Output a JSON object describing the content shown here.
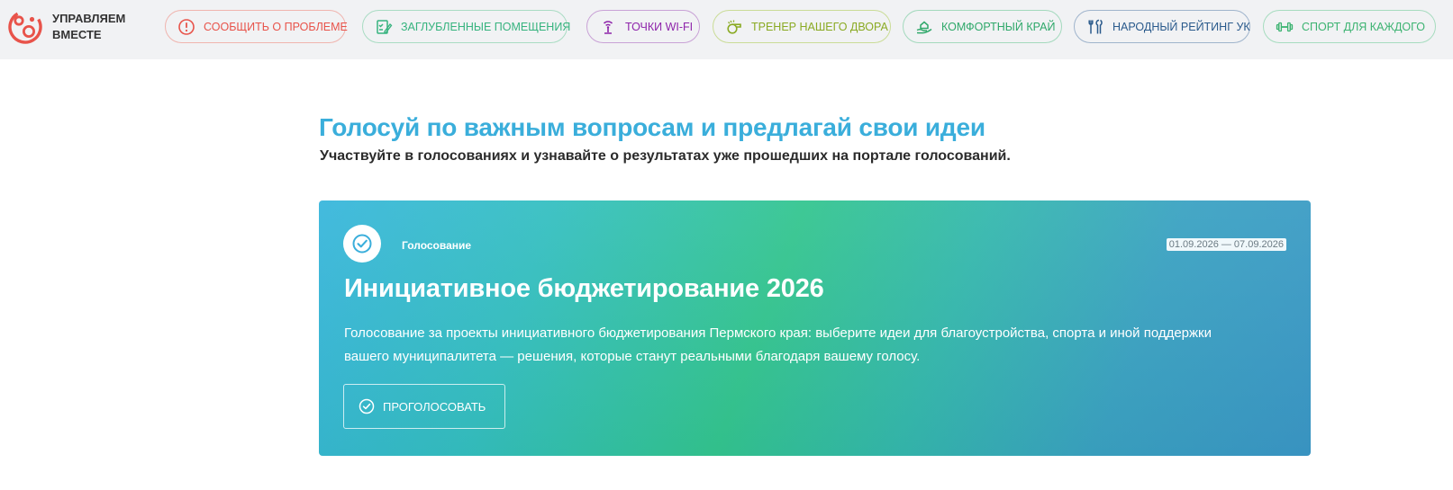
{
  "brand": {
    "name": "УПРАВЛЯЕМ ВМЕСТЕ",
    "color": "#e8534a"
  },
  "nav": [
    {
      "label": "СООБЩИТЬ О ПРОБЛЕМЕ",
      "icon": "alert-circle-icon",
      "color": "#e8534a"
    },
    {
      "label": "ЗАГЛУБЛЕННЫЕ ПОМЕЩЕНИЯ",
      "icon": "checklist-pen-icon",
      "color": "#36b37e"
    },
    {
      "label": "ТОЧКИ WI-FI",
      "icon": "wifi-tower-icon",
      "color": "#8e24aa"
    },
    {
      "label": "ТРЕНЕР НАШЕГО ДВОРА",
      "icon": "whistle-icon",
      "color": "#8aaa23"
    },
    {
      "label": "КОМФОРТНЫЙ КРАЙ",
      "icon": "hand-house-icon",
      "color": "#2fa86a"
    },
    {
      "label": "НАРОДНЫЙ РЕЙТИНГ УК",
      "icon": "tools-icon",
      "color": "#2a5a8c"
    },
    {
      "label": "СПОРТ ДЛЯ КАЖДОГО",
      "icon": "dumbbell-icon",
      "color": "#3cb371"
    }
  ],
  "hero": {
    "title": "Голосуй по важным вопросам и предлагай свои идеи",
    "subtitle": "Участвуйте в голосованиях и узнавайте о результатах уже прошедших на портале голосований."
  },
  "card": {
    "type": "Голосование",
    "dates": "01.09.2026 — 07.09.2026",
    "title": "Инициативное бюджетирование 2026",
    "description": "Голосование за проекты инициативного бюджетирования Пермского края: выберите идеи для благоустройства, спорта и иной поддержки вашего муниципалитета — решения, которые станут реальными благодаря вашему голосу.",
    "button_label": "ПРОГОЛОСОВАТЬ",
    "icon": "check-circle-icon"
  }
}
